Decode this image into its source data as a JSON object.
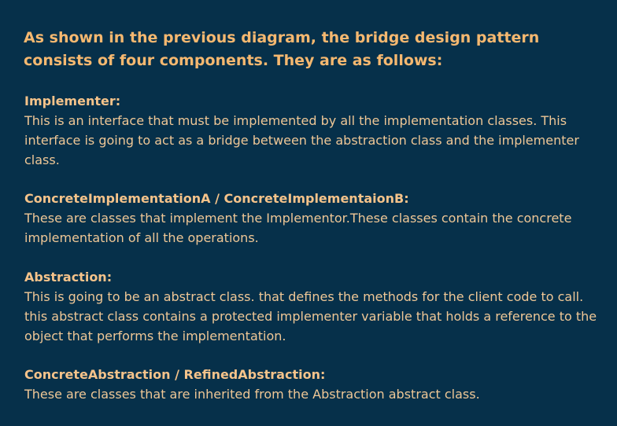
{
  "heading": "As shown in the previous diagram, the bridge design pattern consists of four components. They are as follows:",
  "sections": [
    {
      "title": "Implementer:",
      "body": "This is an interface that must be implemented by all the implementation classes. This interface is going to act as a bridge between the abstraction class and the implementer class."
    },
    {
      "title": "ConcreteImplementationA / ConcreteImplementaionB:",
      "body": "These are classes that implement the Implementor.These classes contain the concrete implementation of all the operations."
    },
    {
      "title": "Abstraction:",
      "body": "This is going to be an abstract class. that defines the methods for the client code to call. this abstract class contains a protected implementer variable that holds a reference to the object that performs the implementation."
    },
    {
      "title": "ConcreteAbstraction / RefinedAbstraction:",
      "body": "These are classes that are inherited from the Abstraction abstract class."
    }
  ]
}
